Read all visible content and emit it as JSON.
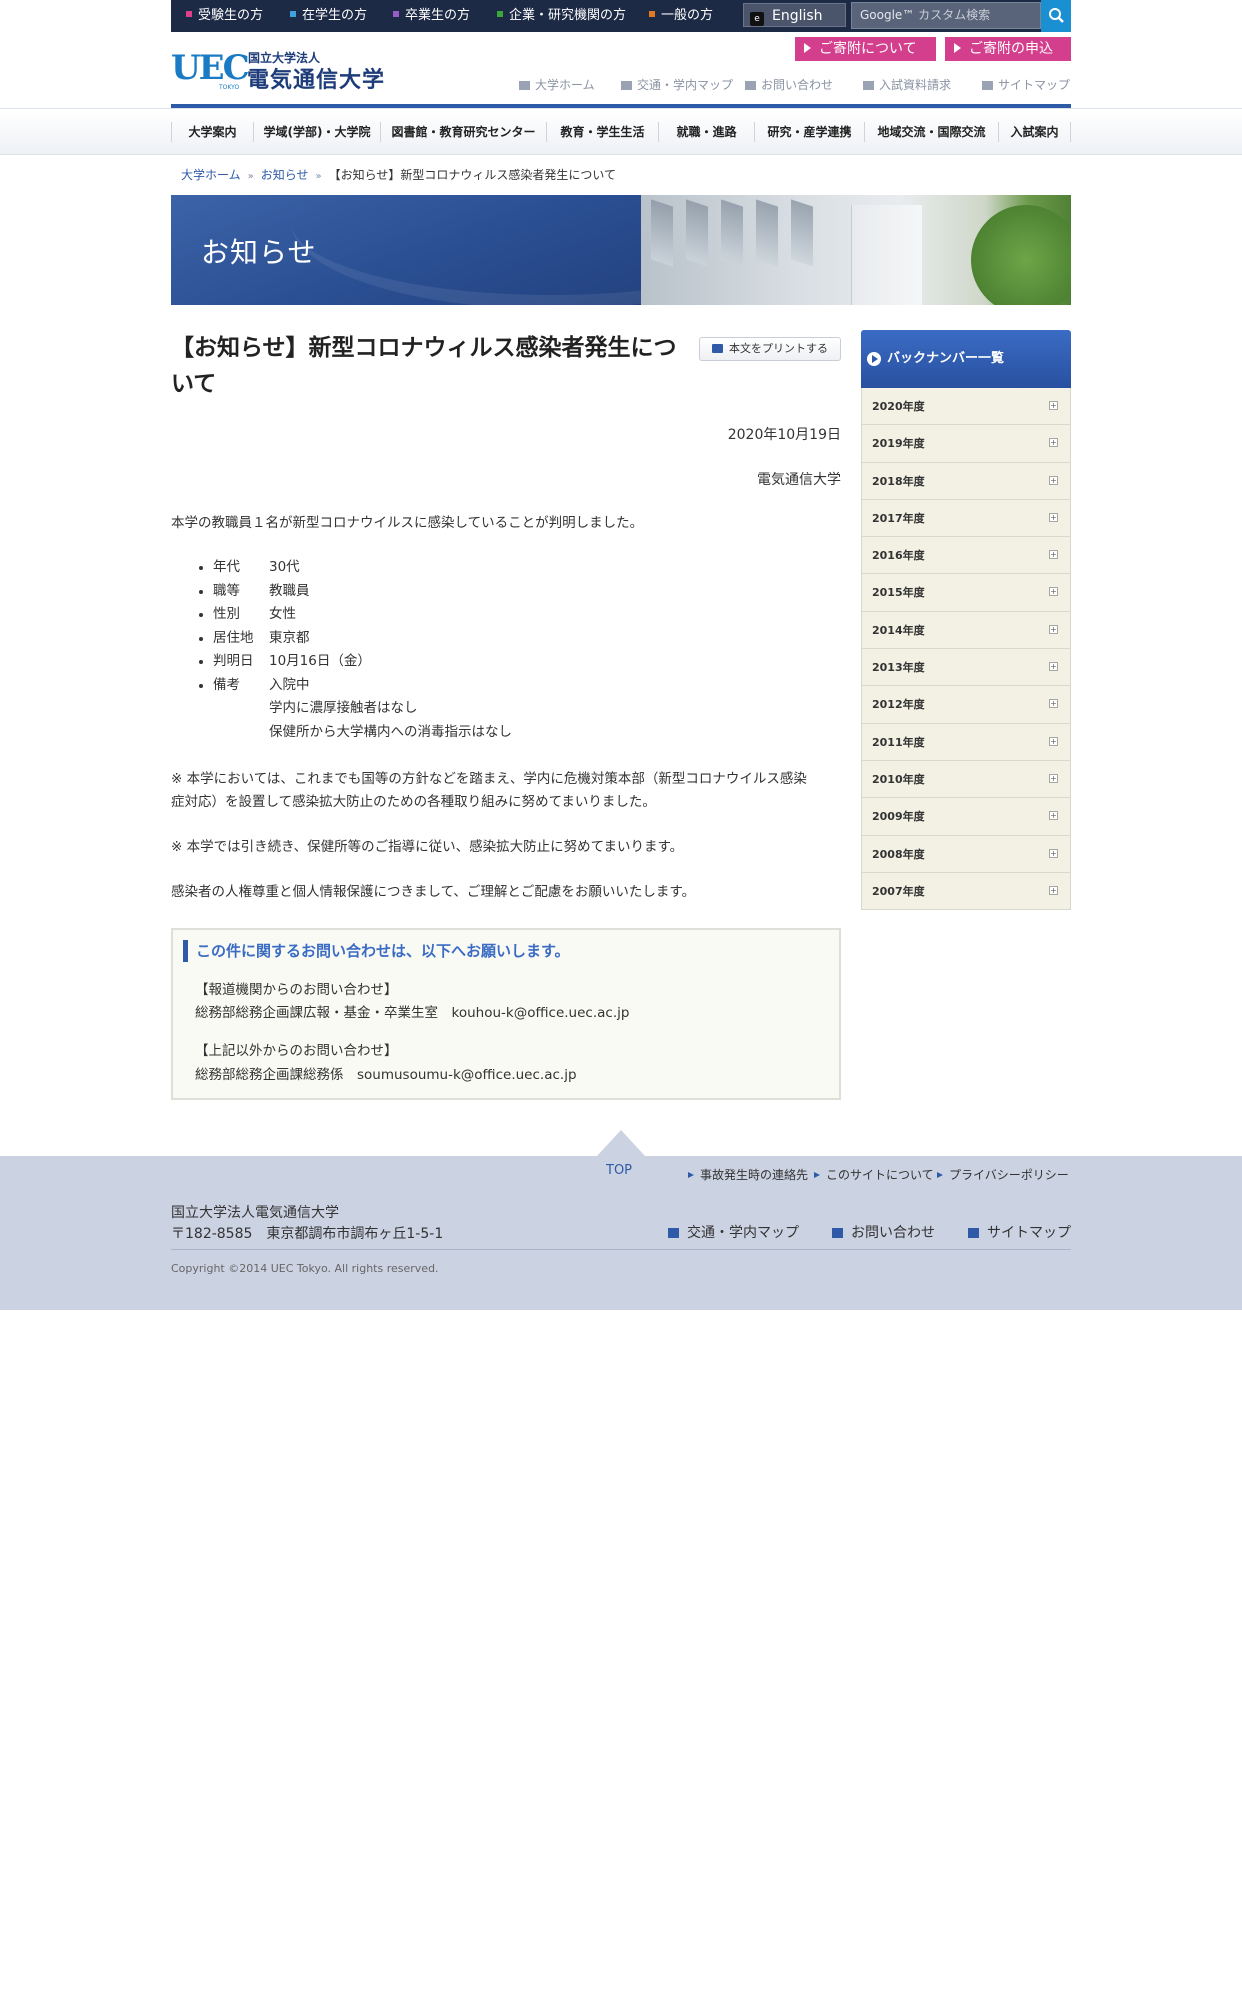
{
  "topbar": {
    "audiences": [
      {
        "label": "受験生の方",
        "color": "#e0408a"
      },
      {
        "label": "在学生の方",
        "color": "#3fa0e0"
      },
      {
        "label": "卒業生の方",
        "color": "#9b5bc8"
      },
      {
        "label": "企業・研究機関の方",
        "color": "#3aa83a"
      },
      {
        "label": "一般の方",
        "color": "#e07a20"
      }
    ],
    "english_label": "English",
    "search_placeholder": "カスタム検索",
    "search_brand": "Google™"
  },
  "header": {
    "logo_mark": "UEC",
    "logo_tokyo": "TOKYO",
    "logo_subtitle": "国立大学法人",
    "logo_title": "電気通信大学",
    "donate_buttons": [
      "ご寄附について",
      "ご寄附の申込"
    ],
    "utility_links": [
      "大学ホーム",
      "交通・学内マップ",
      "お問い合わせ",
      "入試資料請求",
      "サイトマップ"
    ]
  },
  "global_nav": [
    "大学案内",
    "学域(学部)・大学院",
    "図書館・教育研究センター",
    "教育・学生生活",
    "就職・進路",
    "研究・産学連携",
    "地域交流・国際交流",
    "入試案内"
  ],
  "breadcrumb": [
    "大学ホーム",
    "お知らせ",
    "【お知らせ】新型コロナウィルス感染者発生について"
  ],
  "hero": {
    "title": "お知らせ"
  },
  "article": {
    "title": "【お知らせ】新型コロナウィルス感染者発生について",
    "print_label": "本文をプリントする",
    "date": "2020年10月19日",
    "org": "電気通信大学",
    "intro": "本学の教職員１名が新型コロナウイルスに感染していることが判明しました。",
    "details": [
      {
        "key": "年代",
        "value": "30代"
      },
      {
        "key": "職等",
        "value": "教職員"
      },
      {
        "key": "性別",
        "value": "女性"
      },
      {
        "key": "居住地",
        "value": "東京都"
      },
      {
        "key": "判明日",
        "value": "10月16日（金）"
      },
      {
        "key": "備考",
        "value": "入院中",
        "extra": [
          "学内に濃厚接触者はなし",
          "保健所から大学構内への消毒指示はなし"
        ]
      }
    ],
    "note1_line1": "※ 本学においては、これまでも国等の方針などを踏まえ、学内に危機対策本部（新型コロナウイルス感染",
    "note1_line2": "症対応）を設置して感染拡大防止のための各種取り組みに努めてまいりました。",
    "note2": "※ 本学では引き続き、保健所等のご指導に従い、感染拡大防止に努めてまいります。",
    "closing": "感染者の人権尊重と個人情報保護につきまして、ご理解とご配慮をお願いいたします。",
    "contact": {
      "heading": "この件に関するお問い合わせは、以下へお願いします。",
      "press_label": "【報道機関からのお問い合わせ】",
      "press_dept": "総務部総務企画課広報・基金・卒業生室　kouhou-k@office.uec.ac.jp",
      "other_label": "【上記以外からのお問い合わせ】",
      "other_dept": "総務部総務企画課総務係　soumusoumu-k@office.uec.ac.jp"
    }
  },
  "sidebar": {
    "heading": "バックナンバー一覧",
    "years": [
      "2020年度",
      "2019年度",
      "2018年度",
      "2017年度",
      "2016年度",
      "2015年度",
      "2014年度",
      "2013年度",
      "2012年度",
      "2011年度",
      "2010年度",
      "2009年度",
      "2008年度",
      "2007年度"
    ]
  },
  "footer": {
    "top_label": "TOP",
    "links": [
      "事故発生時の連絡先",
      "このサイトについて",
      "プライバシーポリシー"
    ],
    "address_name": "国立大学法人電気通信大学",
    "address_line": "〒182-8585　東京都調布市調布ヶ丘1-5-1",
    "links2": [
      "交通・学内マップ",
      "お問い合わせ",
      "サイトマップ"
    ],
    "copyright": "Copyright ©2014 UEC Tokyo. All rights reserved."
  }
}
